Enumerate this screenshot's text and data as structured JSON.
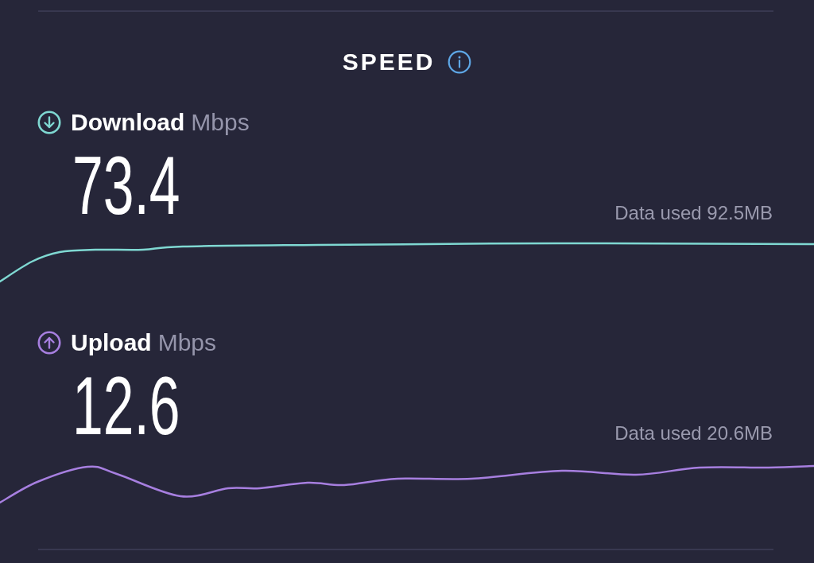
{
  "header": {
    "title": "SPEED"
  },
  "results": [
    {
      "kind": "download",
      "label": "Download",
      "unit": "Mbps",
      "value": "73.4",
      "data_used": "Data used 92.5MB",
      "color": "#7fd8d2"
    },
    {
      "kind": "upload",
      "label": "Upload",
      "unit": "Mbps",
      "value": "12.6",
      "data_used": "Data used 20.6MB",
      "color": "#a77fe0"
    }
  ]
}
